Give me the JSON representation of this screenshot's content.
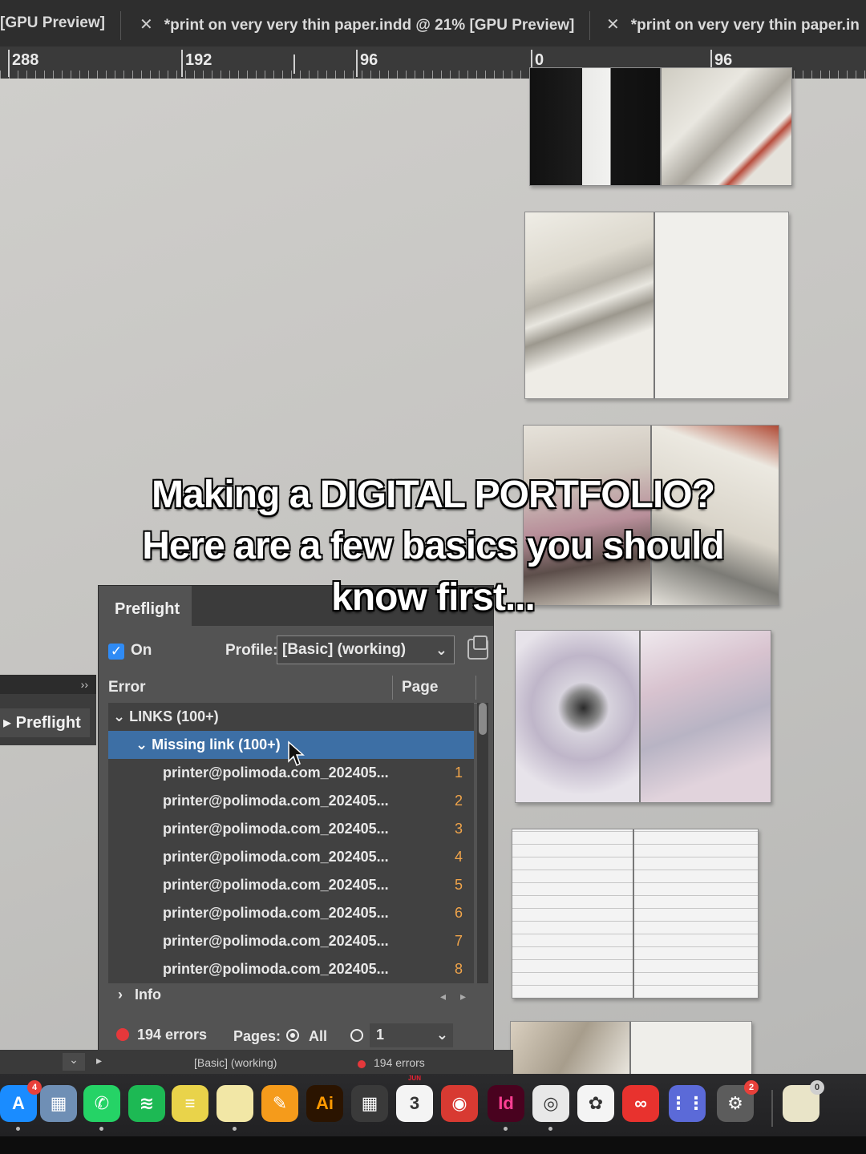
{
  "tabs": [
    {
      "label": "[GPU Preview]"
    },
    {
      "label": "*print on very very thin paper.indd @ 21% [GPU Preview]"
    },
    {
      "label": "*print on very very thin paper.in"
    }
  ],
  "ruler": {
    "labels": [
      "288",
      "192",
      "96",
      "0",
      "96"
    ]
  },
  "caption": {
    "line1": "Making a DIGITAL PORTFOLIO?",
    "line2": "Here are a few basics you should",
    "line3": "know first..."
  },
  "side_panel": {
    "collapse_glyph": "››",
    "label": "Preflight"
  },
  "preflight": {
    "tab_label": "Preflight",
    "on_label": "On",
    "on_checked": true,
    "profile_label": "Profile:",
    "profile_value": "[Basic] (working)",
    "col_error": "Error",
    "col_page": "Page",
    "group": "LINKS (100+)",
    "subgroup": "Missing link (100+)",
    "rows": [
      {
        "name": "printer@polimoda.com_202405...",
        "page": "1"
      },
      {
        "name": "printer@polimoda.com_202405...",
        "page": "2"
      },
      {
        "name": "printer@polimoda.com_202405...",
        "page": "3"
      },
      {
        "name": "printer@polimoda.com_202405...",
        "page": "4"
      },
      {
        "name": "printer@polimoda.com_202405...",
        "page": "5"
      },
      {
        "name": "printer@polimoda.com_202405...",
        "page": "6"
      },
      {
        "name": "printer@polimoda.com_202405...",
        "page": "7"
      },
      {
        "name": "printer@polimoda.com_202405...",
        "page": "8"
      }
    ],
    "info_label": "Info",
    "error_count": "194 errors",
    "pages_label": "Pages:",
    "pages_all": "All",
    "pages_range": "1"
  },
  "status_bar": {
    "profile_text": "[Basic] (working)",
    "errors_text": "194 errors"
  },
  "dock": {
    "apps": [
      {
        "name": "App Store",
        "glyph": "A",
        "color": "#1a8cff",
        "badge": "4"
      },
      {
        "name": "Preview",
        "glyph": "▦",
        "color": "#6f8fb5",
        "badge": ""
      },
      {
        "name": "WhatsApp",
        "glyph": "✆",
        "color": "#25d366",
        "badge": ""
      },
      {
        "name": "Spotify",
        "glyph": "≋",
        "color": "#1db954",
        "badge": ""
      },
      {
        "name": "Stickies",
        "glyph": "≡",
        "color": "#e9d34a",
        "badge": ""
      },
      {
        "name": "Notes",
        "glyph": "",
        "color": "#f2e7a6",
        "badge": ""
      },
      {
        "name": "Pages",
        "glyph": "✎",
        "color": "#f59b1b",
        "badge": ""
      },
      {
        "name": "Illustrator",
        "glyph": "Ai",
        "color": "#2b1400",
        "badge": ""
      },
      {
        "name": "Calculator",
        "glyph": "▦",
        "color": "#3a3a3a",
        "badge": ""
      },
      {
        "name": "Calendar",
        "glyph": "3",
        "color": "#f4f4f4",
        "badge": "",
        "sub": "JUN"
      },
      {
        "name": "Photo Booth",
        "glyph": "◉",
        "color": "#d83a32",
        "badge": ""
      },
      {
        "name": "InDesign",
        "glyph": "Id",
        "color": "#49021f",
        "badge": ""
      },
      {
        "name": "Chrome",
        "glyph": "◎",
        "color": "#e8e8e8",
        "badge": ""
      },
      {
        "name": "Photos",
        "glyph": "✿",
        "color": "#f4f4f4",
        "badge": ""
      },
      {
        "name": "Creative Cloud",
        "glyph": "∞",
        "color": "#e8322e",
        "badge": ""
      },
      {
        "name": "Launchpad",
        "glyph": "⋮⋮",
        "color": "#5b6ad8",
        "badge": ""
      },
      {
        "name": "System Settings",
        "glyph": "⚙",
        "color": "#5c5c5c",
        "badge": "2"
      },
      {
        "name": "Notes Widget",
        "glyph": "",
        "color": "#e9e4c8",
        "badge": "0"
      }
    ]
  },
  "colors": {
    "selection": "#3d6fa5",
    "page_number": "#f0a44a",
    "error_dot": "#e5383b",
    "checkbox": "#2f8bf5"
  }
}
